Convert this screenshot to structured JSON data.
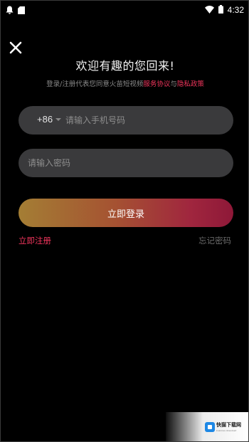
{
  "status_bar": {
    "time": "4:32",
    "icons": [
      "notification-bell-icon",
      "sd-card-icon",
      "wifi-icon",
      "battery-icon"
    ]
  },
  "colors": {
    "background": "#000000",
    "accent": "#f0355c",
    "input_bg": "#3a3a3c",
    "button_gradient_start": "#a47e34",
    "button_gradient_end": "#8e1838"
  },
  "login": {
    "close_icon": "close-icon",
    "title": "欢迎有趣的您回来!",
    "agreement": {
      "prefix": "登录/注册代表您同意火苗短视频",
      "terms": "服务协议",
      "connector": "与",
      "privacy": "隐私政策"
    },
    "phone": {
      "country_code": "+86",
      "placeholder": "请输入手机号码",
      "value": ""
    },
    "password": {
      "placeholder": "请输入密码",
      "value": ""
    },
    "submit_label": "立即登录",
    "register_label": "立即注册",
    "forgot_label": "忘记密码"
  },
  "watermark": {
    "text": "快猫下载网",
    "sub": "kuaimao.download"
  }
}
